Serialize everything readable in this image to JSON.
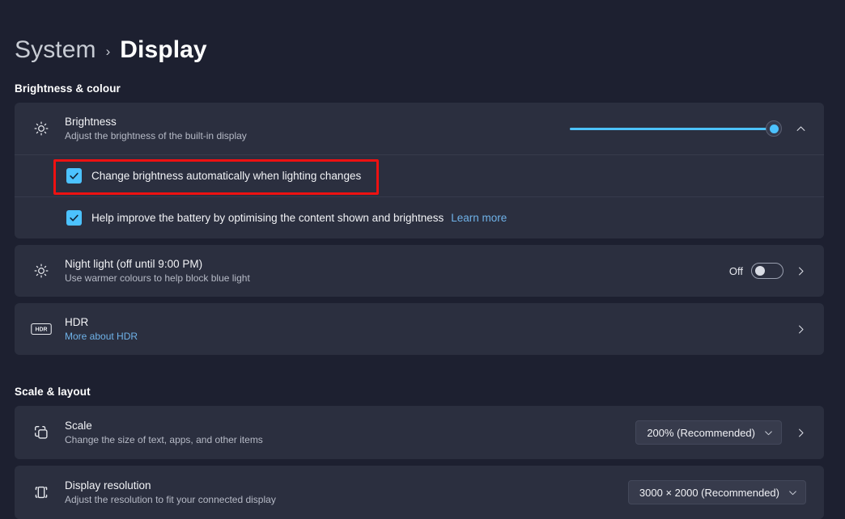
{
  "breadcrumb": {
    "parent": "System",
    "separator": "›",
    "current": "Display"
  },
  "sections": {
    "brightness_colour": "Brightness & colour",
    "scale_layout": "Scale & layout"
  },
  "brightness": {
    "icon": "sun-icon",
    "title": "Brightness",
    "subtitle": "Adjust the brightness of the built-in display",
    "slider_value": 97,
    "expand_icon": "chevron-up-icon",
    "auto_brightness": {
      "label": "Change brightness automatically when lighting changes",
      "checked": true
    },
    "content_adaptive": {
      "label": "Help improve the battery by optimising the content shown and brightness",
      "link": "Learn more",
      "checked": true
    }
  },
  "night_light": {
    "icon": "sun-icon",
    "title": "Night light (off until 9:00 PM)",
    "subtitle": "Use warmer colours to help block blue light",
    "state_label": "Off",
    "toggle_on": false,
    "chevron": "chevron-right-icon"
  },
  "hdr": {
    "icon": "hdr-icon",
    "title": "HDR",
    "link": "More about HDR",
    "chevron": "chevron-right-icon"
  },
  "scale": {
    "icon": "scale-icon",
    "title": "Scale",
    "subtitle": "Change the size of text, apps, and other items",
    "value": "200% (Recommended)",
    "caret": "chevron-down-icon",
    "chevron": "chevron-right-icon"
  },
  "resolution": {
    "icon": "display-resolution-icon",
    "title": "Display resolution",
    "subtitle": "Adjust the resolution to fit your connected display",
    "value": "3000 × 2000 (Recommended)",
    "caret": "chevron-down-icon"
  },
  "colors": {
    "accent": "#4cc2ff",
    "link": "#6fb2e8",
    "card": "#2b2f3f",
    "page": "#1d2030",
    "highlight": "#ee1111"
  }
}
